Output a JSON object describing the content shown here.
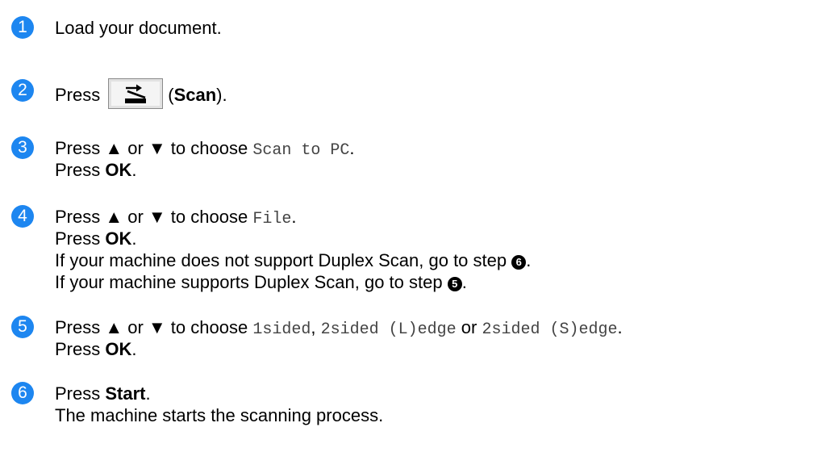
{
  "steps": [
    {
      "number": "1",
      "text": "Load your document."
    },
    {
      "number": "2",
      "press": "Press",
      "scan_open": "(",
      "scan_label": "Scan",
      "scan_close": ")."
    },
    {
      "number": "3",
      "choose_prefix": "Press ▲ or ▼ to choose",
      "option": "Scan to PC",
      "period": ".",
      "press": "Press",
      "ok": "OK"
    },
    {
      "number": "4",
      "choose_prefix": "Press ▲ or ▼ to choose",
      "option": "File",
      "period": ".",
      "press": "Press",
      "ok": "OK",
      "no_duplex_text": "If your machine does not support Duplex Scan, go to step",
      "no_duplex_ref": "6",
      "duplex_text": "If your machine supports Duplex Scan, go to step",
      "duplex_ref": "5"
    },
    {
      "number": "5",
      "choose_prefix": "Press ▲ or ▼ to choose",
      "option_1": "1sided",
      "comma": ",",
      "option_2": "2sided (L)edge",
      "or": "or",
      "option_3": "2sided (S)edge",
      "period": ".",
      "press": "Press",
      "ok": "OK"
    },
    {
      "number": "6",
      "press": "Press",
      "start": "Start",
      "period": ".",
      "result": "The machine starts the scanning process."
    }
  ],
  "colors": {
    "step_badge": "#1d86f0",
    "mono_text": "#444444"
  },
  "icons": {
    "scan_button": "scan-icon"
  }
}
